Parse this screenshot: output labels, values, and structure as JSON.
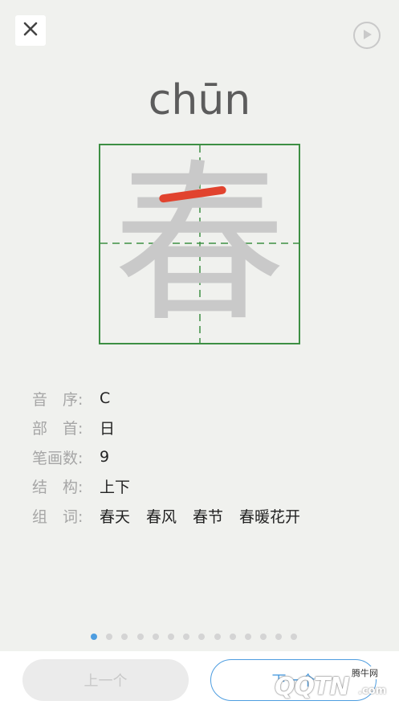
{
  "header": {
    "close_icon": "close-icon",
    "play_icon": "play-circle-icon"
  },
  "character": {
    "pinyin": "chūn",
    "hanzi": "春",
    "highlight_color": "#e1432e",
    "grid_color": "#3d8f43"
  },
  "info": {
    "rows": [
      {
        "label": "音　序:",
        "value": "C"
      },
      {
        "label": "部　首:",
        "value": "日"
      },
      {
        "label": "笔画数:",
        "value": "9"
      },
      {
        "label": "结　构:",
        "value": "上下"
      }
    ],
    "words_label": "组　词:",
    "words": [
      "春天",
      "春风",
      "春节",
      "春暖花开"
    ]
  },
  "pagination": {
    "total": 14,
    "current": 1,
    "active_color": "#4d9de0"
  },
  "footer": {
    "prev_label": "上一个",
    "next_label": "下一个"
  },
  "watermark": {
    "small_text": "腾牛网",
    "brand_text": "QQTN",
    "suffix_text": ".com"
  }
}
